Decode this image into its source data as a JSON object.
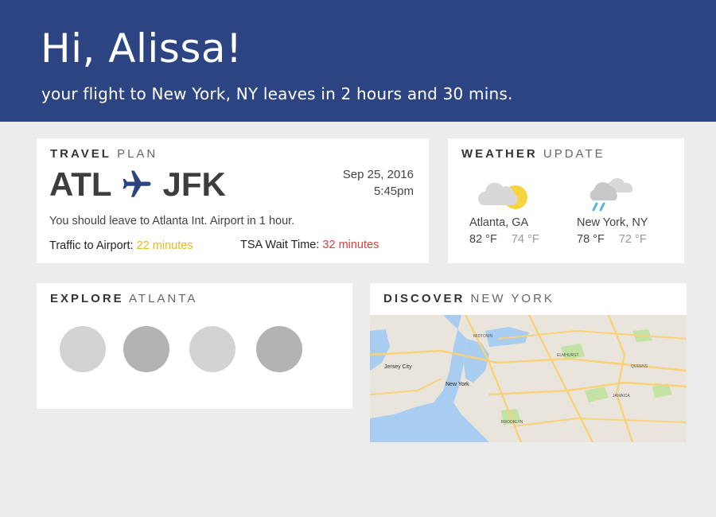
{
  "header": {
    "greeting": "Hi, Alissa!",
    "subtitle": "your flight to New York, NY leaves in 2 hours and 30 mins."
  },
  "travel": {
    "title_bold": "TRAVEL",
    "title_rest": "PLAN",
    "from": "ATL",
    "to": "JFK",
    "plane_icon": "airplane-icon",
    "date": "Sep 25, 2016",
    "time": "5:45pm",
    "leave_note": "You should leave to Atlanta Int. Airport in 1 hour.",
    "traffic_label": "Traffic to Airport:",
    "traffic_value": "22 minutes",
    "tsa_label": "TSA Wait Time:",
    "tsa_value": "32 minutes",
    "colors": {
      "traffic": "#e8b91f",
      "tsa": "#d9403a",
      "plane": "#2d4482"
    }
  },
  "weather": {
    "title_bold": "WEATHER",
    "title_rest": "UPDATE",
    "locations": [
      {
        "city": "Atlanta, GA",
        "high": "82 °F",
        "low": "74 °F",
        "icon": "partly-sunny-icon"
      },
      {
        "city": "New York, NY",
        "high": "78 °F",
        "low": "72 °F",
        "icon": "rain-cloud-icon"
      }
    ]
  },
  "explore": {
    "title_bold": "EXPLORE",
    "title_rest": "ATLANTA",
    "placeholders": [
      "#d3d3d3",
      "#b3b3b3",
      "#d3d3d3",
      "#b3b3b3"
    ]
  },
  "discover": {
    "title_bold": "DISCOVER",
    "title_rest": "NEW YORK",
    "map_labels": {
      "jersey_city": "Jersey City",
      "new_york": "New York",
      "queens": "QUEENS",
      "brooklyn": "BROOKLYN",
      "elmhurst": "ELMHURST",
      "jamaica": "JAMAICA",
      "midtown": "MIDTOWN"
    }
  },
  "header_color": "#2d4482",
  "background_color": "#ececec"
}
